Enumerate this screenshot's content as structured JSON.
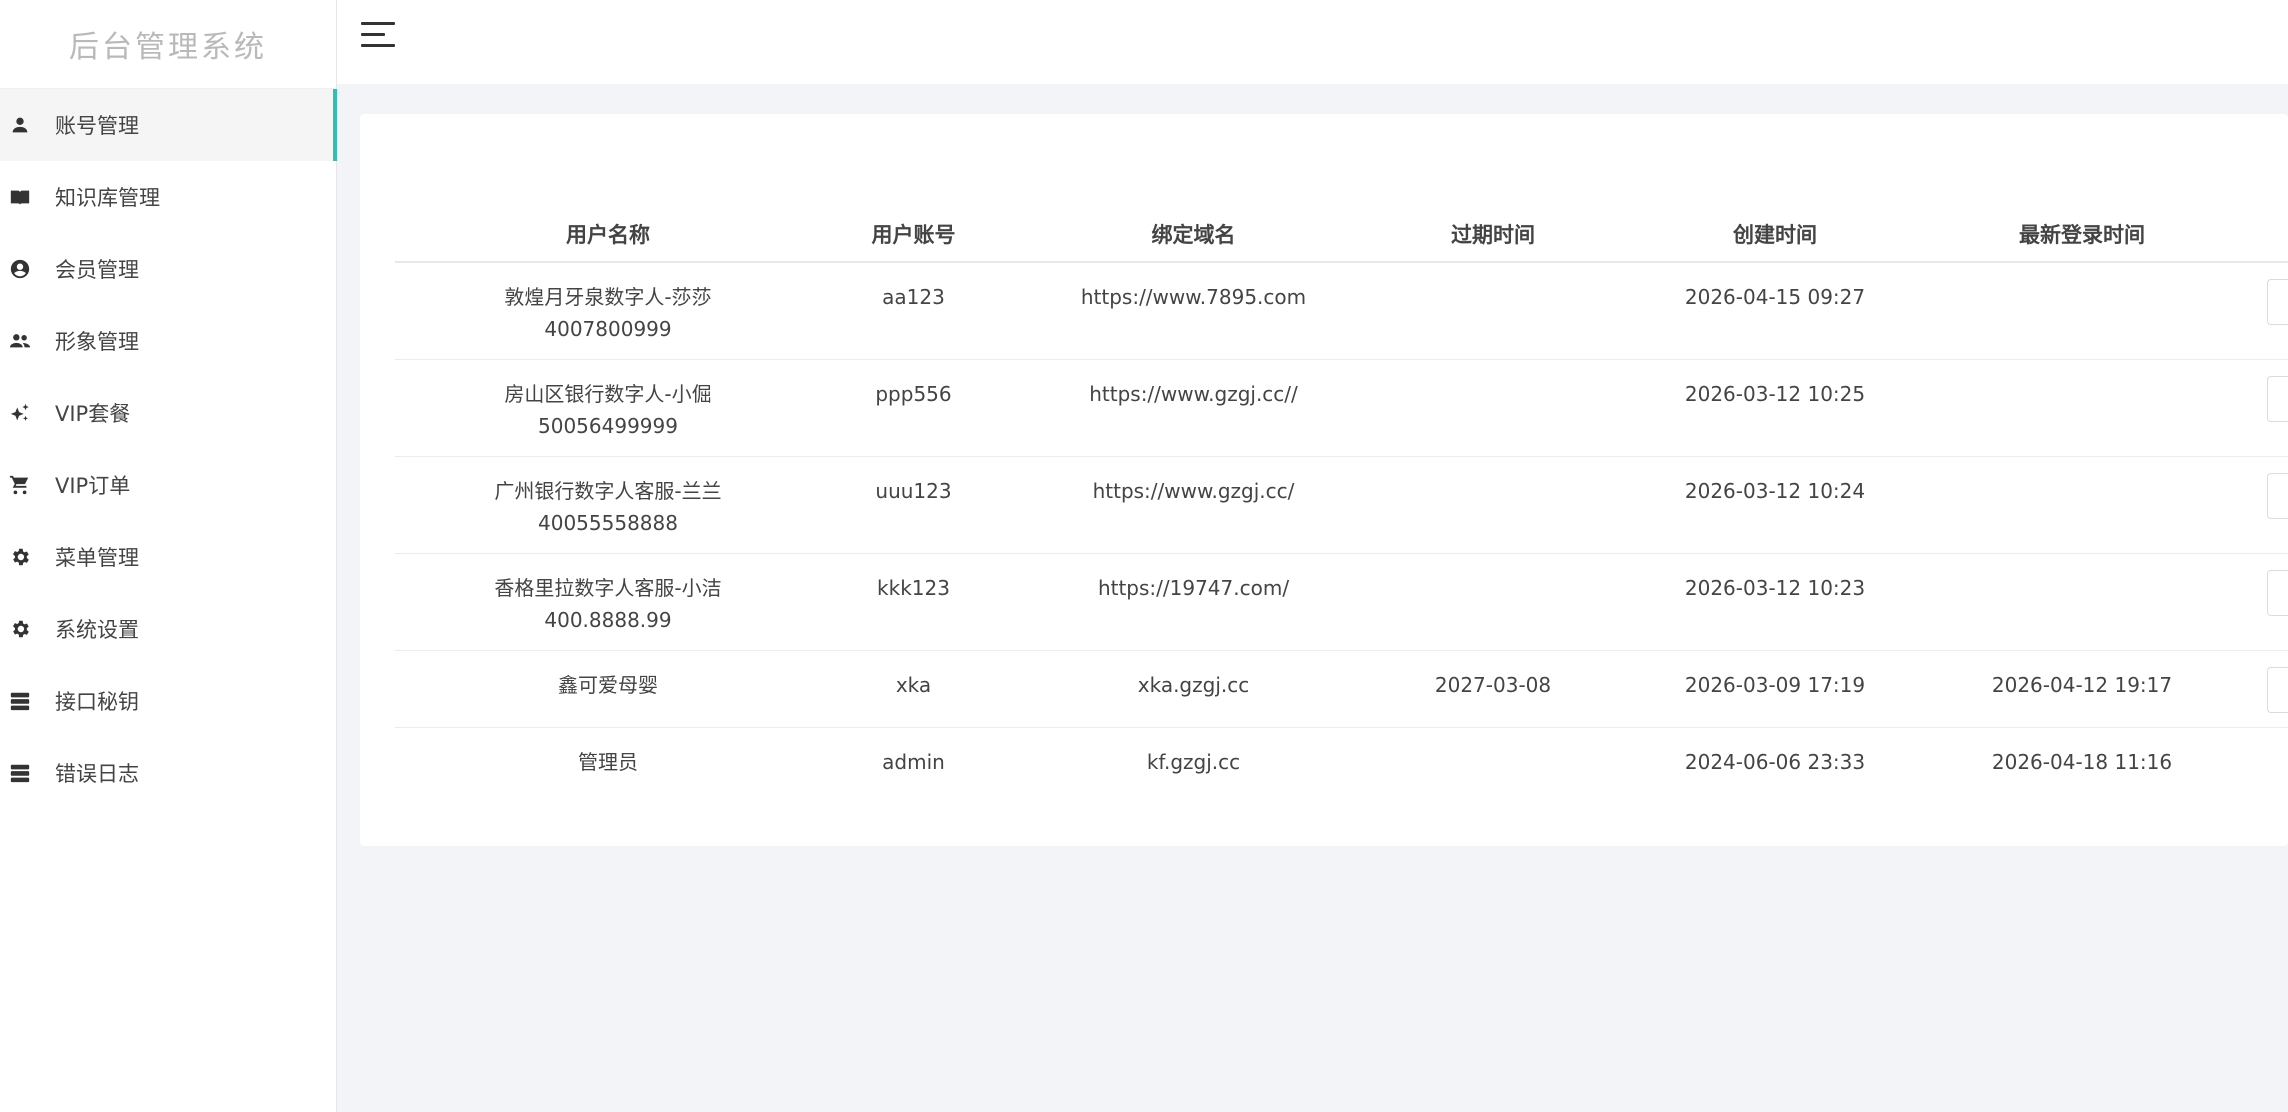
{
  "app": {
    "title": "后台管理系统"
  },
  "sidebar": {
    "items": [
      {
        "label": "账号管理",
        "icon": "person-icon",
        "active": true
      },
      {
        "label": "知识库管理",
        "icon": "book-icon"
      },
      {
        "label": "会员管理",
        "icon": "account-circle-icon"
      },
      {
        "label": "形象管理",
        "icon": "people-icon"
      },
      {
        "label": "VIP套餐",
        "icon": "sparkle-icon"
      },
      {
        "label": "VIP订单",
        "icon": "cart-icon"
      },
      {
        "label": "菜单管理",
        "icon": "gear-icon"
      },
      {
        "label": "系统设置",
        "icon": "gear-icon"
      },
      {
        "label": "接口秘钥",
        "icon": "server-icon"
      },
      {
        "label": "错误日志",
        "icon": "server-icon"
      }
    ]
  },
  "header": {
    "menu_icon": "hamburger-icon"
  },
  "table": {
    "columns": [
      "用户名称",
      "用户账号",
      "绑定域名",
      "过期时间",
      "创建时间",
      "最新登录时间"
    ],
    "rows": [
      {
        "name": "敦煌月牙泉数字人-莎莎",
        "phone": "4007800999",
        "account": "aa123",
        "domain": "https://www.7895.com",
        "expire": "",
        "created": "2026-04-15 09:27",
        "last_login": ""
      },
      {
        "name": "房山区银行数字人-小倔",
        "phone": "50056499999",
        "account": "ppp556",
        "domain": "https://www.gzgj.cc//",
        "expire": "",
        "created": "2026-03-12 10:25",
        "last_login": ""
      },
      {
        "name": "广州银行数字人客服-兰兰",
        "phone": "40055558888",
        "account": "uuu123",
        "domain": "https://www.gzgj.cc/",
        "expire": "",
        "created": "2026-03-12 10:24",
        "last_login": ""
      },
      {
        "name": "香格里拉数字人客服-小洁",
        "phone": "400.8888.99",
        "account": "kkk123",
        "domain": "https://19747.com/",
        "expire": "",
        "created": "2026-03-12 10:23",
        "last_login": ""
      },
      {
        "name": "鑫可爱母婴",
        "phone": "",
        "account": "xka",
        "domain": "xka.gzgj.cc",
        "expire": "2027-03-08",
        "created": "2026-03-09 17:19",
        "last_login": "2026-04-12 19:17"
      },
      {
        "name": "管理员",
        "phone": "",
        "account": "admin",
        "domain": "kf.gzgj.cc",
        "expire": "",
        "created": "2024-06-06 23:33",
        "last_login": "2026-04-18 11:16"
      }
    ]
  },
  "colors": {
    "accent": "#2fc1b0",
    "background": "#f3f4f7"
  }
}
